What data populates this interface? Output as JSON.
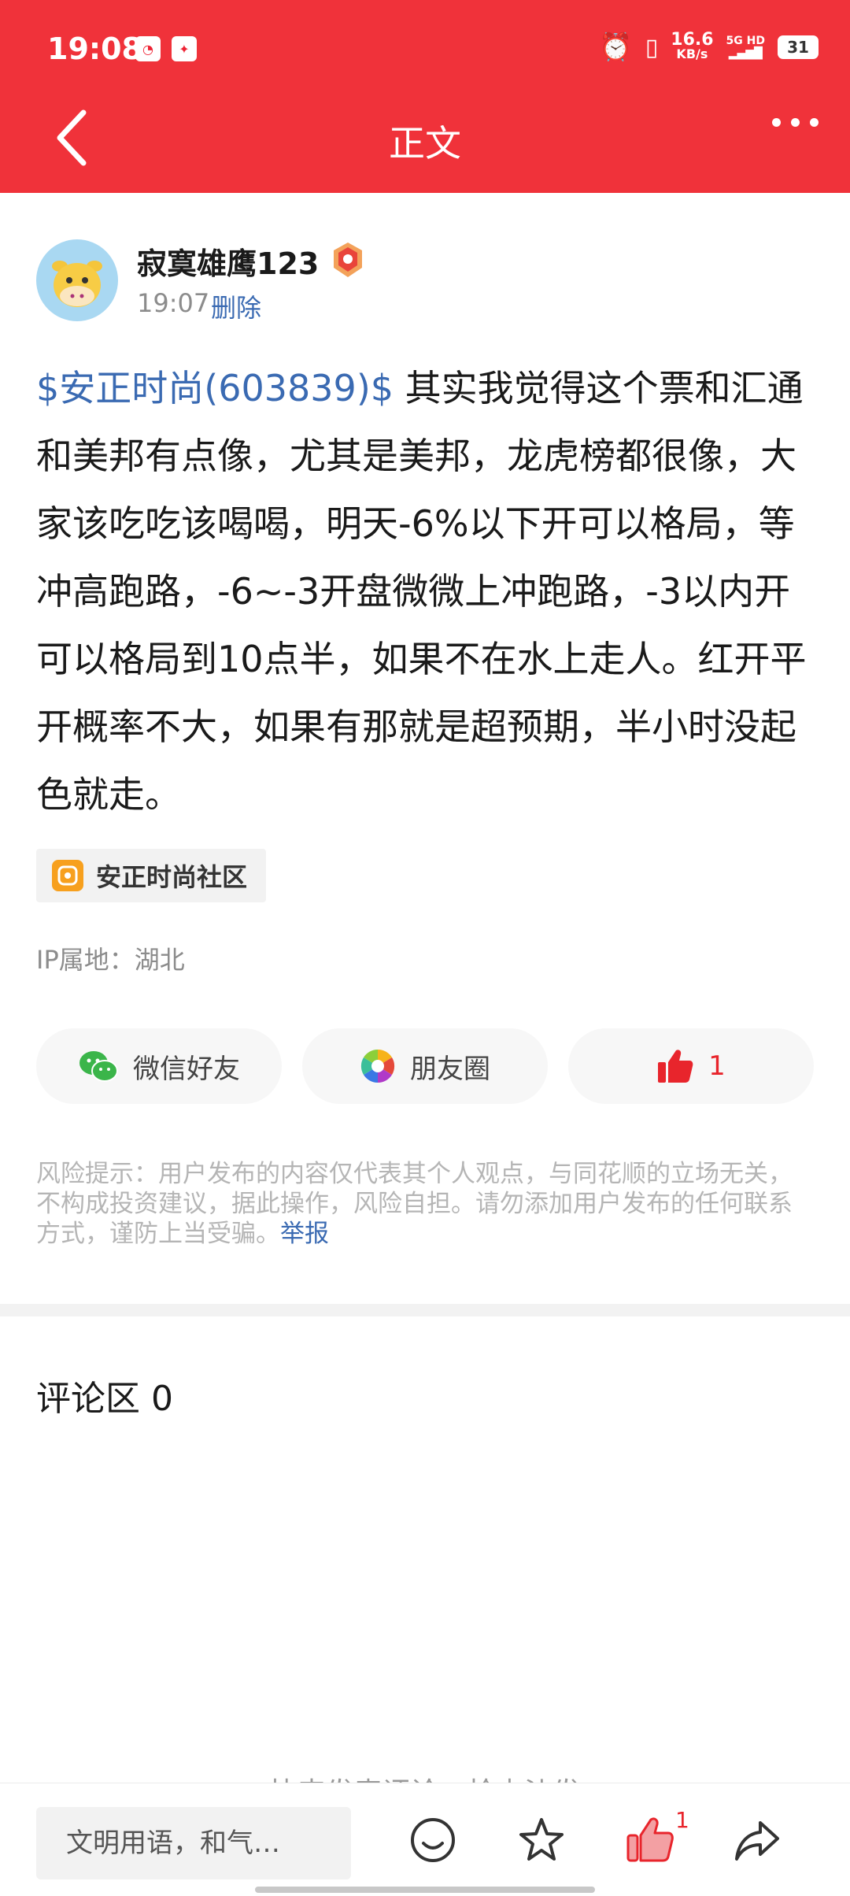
{
  "status_bar": {
    "time": "19:08",
    "speed_value": "16.6",
    "speed_unit": "KB/s",
    "network_top": "5G HD",
    "battery": "31"
  },
  "nav": {
    "title": "正文"
  },
  "author": {
    "name": "寂寞雄鹰123",
    "time": "19:07",
    "delete_label": "删除"
  },
  "post": {
    "stock_link": "$安正时尚(603839)$",
    "text": " 其实我觉得这个票和汇通和美邦有点像，尤其是美邦，龙虎榜都很像，大家该吃吃该喝喝，明天-6%以下开可以格局，等冲高跑路，-6~-3开盘微微上冲跑路，-3以内开可以格局到10点半，如果不在水上走人。红开平开概率不大，如果有那就是超预期，半小时没起色就走。"
  },
  "community": {
    "label": "安正时尚社区"
  },
  "ip_location": "IP属地：湖北",
  "share": {
    "wechat_label": "微信好友",
    "moments_label": "朋友圈",
    "like_count": "1"
  },
  "risk": {
    "text": "风险提示：用户发布的内容仅代表其个人观点，与同花顺的立场无关，不构成投资建议，据此操作，风险自担。请勿添加用户发布的任何联系方式，谨防上当受骗。",
    "report_label": "举报"
  },
  "comments": {
    "title": "评论区 0",
    "empty_hint": "快来发表评论，抢占沙发"
  },
  "bottom_bar": {
    "input_placeholder": "文明用语，和气…",
    "like_count": "1"
  },
  "colors": {
    "brand_red": "#f0323a",
    "link_blue": "#3a6ab2"
  }
}
